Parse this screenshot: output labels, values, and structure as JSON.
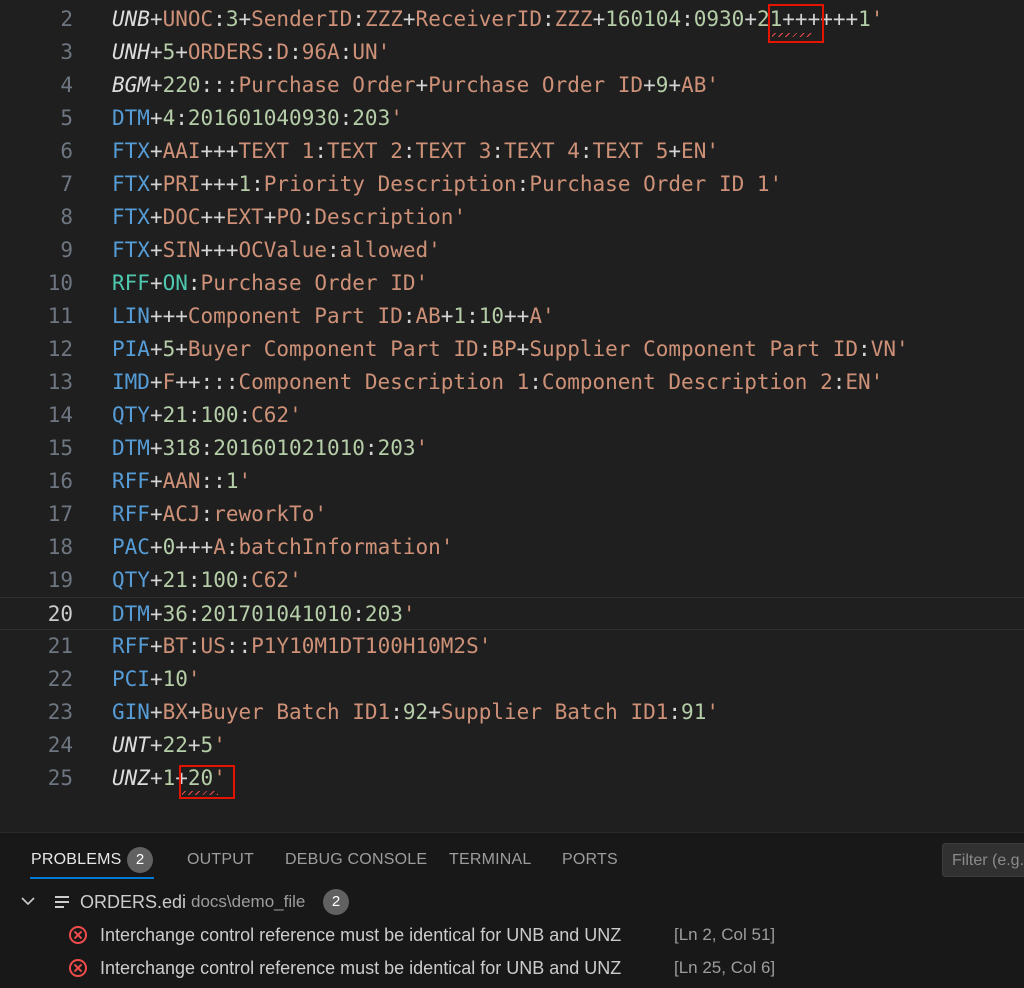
{
  "editor": {
    "current_line": "20",
    "lines": [
      {
        "n": "2",
        "parts": [
          [
            "tag-i",
            "UNB"
          ],
          [
            "sep",
            "+"
          ],
          [
            "str",
            "UNOC"
          ],
          [
            "sep",
            ":"
          ],
          [
            "num",
            "3"
          ],
          [
            "sep",
            "+"
          ],
          [
            "str",
            "SenderID"
          ],
          [
            "sep",
            ":"
          ],
          [
            "str",
            "ZZZ"
          ],
          [
            "sep",
            "+"
          ],
          [
            "str",
            "ReceiverID"
          ],
          [
            "sep",
            ":"
          ],
          [
            "str",
            "ZZZ"
          ],
          [
            "sep",
            "+"
          ],
          [
            "num",
            "160104"
          ],
          [
            "sep",
            ":"
          ],
          [
            "num",
            "0930"
          ],
          [
            "sep",
            "+"
          ],
          [
            "num",
            "21"
          ],
          [
            "sep",
            "++++++"
          ],
          [
            "num",
            "1"
          ],
          [
            "str",
            "'"
          ]
        ]
      },
      {
        "n": "3",
        "parts": [
          [
            "tag-i",
            "UNH"
          ],
          [
            "sep",
            "+"
          ],
          [
            "num",
            "5"
          ],
          [
            "sep",
            "+"
          ],
          [
            "str",
            "ORDERS"
          ],
          [
            "sep",
            ":"
          ],
          [
            "str",
            "D"
          ],
          [
            "sep",
            ":"
          ],
          [
            "str",
            "96A"
          ],
          [
            "sep",
            ":"
          ],
          [
            "str",
            "UN"
          ],
          [
            "str",
            "'"
          ]
        ]
      },
      {
        "n": "4",
        "parts": [
          [
            "tag-i",
            "BGM"
          ],
          [
            "sep",
            "+"
          ],
          [
            "num",
            "220"
          ],
          [
            "sep",
            ":::"
          ],
          [
            "str",
            "Purchase Order"
          ],
          [
            "sep",
            "+"
          ],
          [
            "str",
            "Purchase Order ID"
          ],
          [
            "sep",
            "+"
          ],
          [
            "num",
            "9"
          ],
          [
            "sep",
            "+"
          ],
          [
            "str",
            "AB"
          ],
          [
            "str",
            "'"
          ]
        ]
      },
      {
        "n": "5",
        "parts": [
          [
            "tag",
            "DTM"
          ],
          [
            "sep",
            "+"
          ],
          [
            "num",
            "4"
          ],
          [
            "sep",
            ":"
          ],
          [
            "num",
            "201601040930"
          ],
          [
            "sep",
            ":"
          ],
          [
            "num",
            "203"
          ],
          [
            "str",
            "'"
          ]
        ]
      },
      {
        "n": "6",
        "parts": [
          [
            "tag",
            "FTX"
          ],
          [
            "sep",
            "+"
          ],
          [
            "str",
            "AAI"
          ],
          [
            "sep",
            "+++"
          ],
          [
            "str",
            "TEXT 1"
          ],
          [
            "sep",
            ":"
          ],
          [
            "str",
            "TEXT 2"
          ],
          [
            "sep",
            ":"
          ],
          [
            "str",
            "TEXT 3"
          ],
          [
            "sep",
            ":"
          ],
          [
            "str",
            "TEXT 4"
          ],
          [
            "sep",
            ":"
          ],
          [
            "str",
            "TEXT 5"
          ],
          [
            "sep",
            "+"
          ],
          [
            "str",
            "EN"
          ],
          [
            "str",
            "'"
          ]
        ]
      },
      {
        "n": "7",
        "parts": [
          [
            "tag",
            "FTX"
          ],
          [
            "sep",
            "+"
          ],
          [
            "str",
            "PRI"
          ],
          [
            "sep",
            "+++"
          ],
          [
            "num",
            "1"
          ],
          [
            "sep",
            ":"
          ],
          [
            "str",
            "Priority Description"
          ],
          [
            "sep",
            ":"
          ],
          [
            "str",
            "Purchase Order ID 1"
          ],
          [
            "str",
            "'"
          ]
        ]
      },
      {
        "n": "8",
        "parts": [
          [
            "tag",
            "FTX"
          ],
          [
            "sep",
            "+"
          ],
          [
            "str",
            "DOC"
          ],
          [
            "sep",
            "++"
          ],
          [
            "str",
            "EXT"
          ],
          [
            "sep",
            "+"
          ],
          [
            "str",
            "PO"
          ],
          [
            "sep",
            ":"
          ],
          [
            "str",
            "Description"
          ],
          [
            "str",
            "'"
          ]
        ]
      },
      {
        "n": "9",
        "parts": [
          [
            "tag",
            "FTX"
          ],
          [
            "sep",
            "+"
          ],
          [
            "str",
            "SIN"
          ],
          [
            "sep",
            "+++"
          ],
          [
            "str",
            "OCValue"
          ],
          [
            "sep",
            ":"
          ],
          [
            "str",
            "allowed"
          ],
          [
            "str",
            "'"
          ]
        ]
      },
      {
        "n": "10",
        "parts": [
          [
            "rff",
            "RFF"
          ],
          [
            "sep",
            "+"
          ],
          [
            "rff",
            "ON"
          ],
          [
            "sep",
            ":"
          ],
          [
            "str",
            "Purchase Order ID"
          ],
          [
            "str",
            "'"
          ]
        ]
      },
      {
        "n": "11",
        "parts": [
          [
            "tag",
            "LIN"
          ],
          [
            "sep",
            "+++"
          ],
          [
            "str",
            "Component Part ID"
          ],
          [
            "sep",
            ":"
          ],
          [
            "str",
            "AB"
          ],
          [
            "sep",
            "+"
          ],
          [
            "num",
            "1"
          ],
          [
            "sep",
            ":"
          ],
          [
            "num",
            "10"
          ],
          [
            "sep",
            "++"
          ],
          [
            "str",
            "A"
          ],
          [
            "str",
            "'"
          ]
        ]
      },
      {
        "n": "12",
        "parts": [
          [
            "tag",
            "PIA"
          ],
          [
            "sep",
            "+"
          ],
          [
            "num",
            "5"
          ],
          [
            "sep",
            "+"
          ],
          [
            "str",
            "Buyer Component Part ID"
          ],
          [
            "sep",
            ":"
          ],
          [
            "str",
            "BP"
          ],
          [
            "sep",
            "+"
          ],
          [
            "str",
            "Supplier Component Part ID"
          ],
          [
            "sep",
            ":"
          ],
          [
            "str",
            "VN"
          ],
          [
            "str",
            "'"
          ]
        ]
      },
      {
        "n": "13",
        "parts": [
          [
            "tag",
            "IMD"
          ],
          [
            "sep",
            "+"
          ],
          [
            "str",
            "F"
          ],
          [
            "sep",
            "++:::"
          ],
          [
            "str",
            "Component Description 1"
          ],
          [
            "sep",
            ":"
          ],
          [
            "str",
            "Component Description 2"
          ],
          [
            "sep",
            ":"
          ],
          [
            "str",
            "EN"
          ],
          [
            "str",
            "'"
          ]
        ]
      },
      {
        "n": "14",
        "parts": [
          [
            "tag",
            "QTY"
          ],
          [
            "sep",
            "+"
          ],
          [
            "num",
            "21"
          ],
          [
            "sep",
            ":"
          ],
          [
            "num",
            "100"
          ],
          [
            "sep",
            ":"
          ],
          [
            "str",
            "C62"
          ],
          [
            "str",
            "'"
          ]
        ]
      },
      {
        "n": "15",
        "parts": [
          [
            "tag",
            "DTM"
          ],
          [
            "sep",
            "+"
          ],
          [
            "num",
            "318"
          ],
          [
            "sep",
            ":"
          ],
          [
            "num",
            "201601021010"
          ],
          [
            "sep",
            ":"
          ],
          [
            "num",
            "203"
          ],
          [
            "str",
            "'"
          ]
        ]
      },
      {
        "n": "16",
        "parts": [
          [
            "tag",
            "RFF"
          ],
          [
            "sep",
            "+"
          ],
          [
            "str",
            "AAN"
          ],
          [
            "sep",
            "::"
          ],
          [
            "num",
            "1"
          ],
          [
            "str",
            "'"
          ]
        ]
      },
      {
        "n": "17",
        "parts": [
          [
            "tag",
            "RFF"
          ],
          [
            "sep",
            "+"
          ],
          [
            "str",
            "ACJ"
          ],
          [
            "sep",
            ":"
          ],
          [
            "str",
            "reworkTo"
          ],
          [
            "str",
            "'"
          ]
        ]
      },
      {
        "n": "18",
        "parts": [
          [
            "tag",
            "PAC"
          ],
          [
            "sep",
            "+"
          ],
          [
            "num",
            "0"
          ],
          [
            "sep",
            "+++"
          ],
          [
            "str",
            "A"
          ],
          [
            "sep",
            ":"
          ],
          [
            "str",
            "batchInformation"
          ],
          [
            "str",
            "'"
          ]
        ]
      },
      {
        "n": "19",
        "parts": [
          [
            "tag",
            "QTY"
          ],
          [
            "sep",
            "+"
          ],
          [
            "num",
            "21"
          ],
          [
            "sep",
            ":"
          ],
          [
            "num",
            "100"
          ],
          [
            "sep",
            ":"
          ],
          [
            "str",
            "C62"
          ],
          [
            "str",
            "'"
          ]
        ]
      },
      {
        "n": "20",
        "parts": [
          [
            "tag",
            "DTM"
          ],
          [
            "sep",
            "+"
          ],
          [
            "num",
            "36"
          ],
          [
            "sep",
            ":"
          ],
          [
            "num",
            "201701041010"
          ],
          [
            "sep",
            ":"
          ],
          [
            "num",
            "203"
          ],
          [
            "str",
            "'"
          ]
        ]
      },
      {
        "n": "21",
        "parts": [
          [
            "tag",
            "RFF"
          ],
          [
            "sep",
            "+"
          ],
          [
            "str",
            "BT"
          ],
          [
            "sep",
            ":"
          ],
          [
            "str",
            "US"
          ],
          [
            "sep",
            "::"
          ],
          [
            "str",
            "P1Y10M1DT100H10M2S"
          ],
          [
            "str",
            "'"
          ]
        ]
      },
      {
        "n": "22",
        "parts": [
          [
            "tag",
            "PCI"
          ],
          [
            "sep",
            "+"
          ],
          [
            "num",
            "10"
          ],
          [
            "str",
            "'"
          ]
        ]
      },
      {
        "n": "23",
        "parts": [
          [
            "tag",
            "GIN"
          ],
          [
            "sep",
            "+"
          ],
          [
            "str",
            "BX"
          ],
          [
            "sep",
            "+"
          ],
          [
            "str",
            "Buyer Batch ID1"
          ],
          [
            "sep",
            ":"
          ],
          [
            "num",
            "92"
          ],
          [
            "sep",
            "+"
          ],
          [
            "str",
            "Supplier Batch ID1"
          ],
          [
            "sep",
            ":"
          ],
          [
            "num",
            "91"
          ],
          [
            "str",
            "'"
          ]
        ]
      },
      {
        "n": "24",
        "parts": [
          [
            "tag-i",
            "UNT"
          ],
          [
            "sep",
            "+"
          ],
          [
            "num",
            "22"
          ],
          [
            "sep",
            "+"
          ],
          [
            "num",
            "5"
          ],
          [
            "str",
            "'"
          ]
        ]
      },
      {
        "n": "25",
        "parts": [
          [
            "tag-i",
            "UNZ"
          ],
          [
            "sep",
            "+"
          ],
          [
            "num",
            "1"
          ],
          [
            "sep",
            "+"
          ],
          [
            "num",
            "20"
          ],
          [
            "str",
            "'"
          ]
        ]
      }
    ]
  },
  "panel": {
    "tabs": [
      {
        "label": "PROBLEMS",
        "active": true,
        "badge": "2"
      },
      {
        "label": "OUTPUT"
      },
      {
        "label": "DEBUG CONSOLE"
      },
      {
        "label": "TERMINAL"
      },
      {
        "label": "PORTS"
      }
    ],
    "filter_placeholder": "Filter (e.g. text, **/*.ts, !**/node_modules/**)",
    "file": {
      "name": "ORDERS.edi",
      "path": "docs\\demo_file",
      "count": "2"
    },
    "problems": [
      {
        "message": "Interchange control reference must be identical for UNB and UNZ",
        "location": "[Ln 2, Col 51]"
      },
      {
        "message": "Interchange control reference must be identical for UNB and UNZ",
        "location": "[Ln 25, Col 6]"
      }
    ]
  },
  "colors": {
    "background": "#1f1f1f",
    "segment_tag": "#569cd6",
    "string": "#ce9178",
    "number": "#b5cea8",
    "error": "#f14c4c",
    "accent": "#0078d4"
  },
  "icons": [
    "chevron-down-icon",
    "file-lines-icon",
    "error-icon"
  ]
}
